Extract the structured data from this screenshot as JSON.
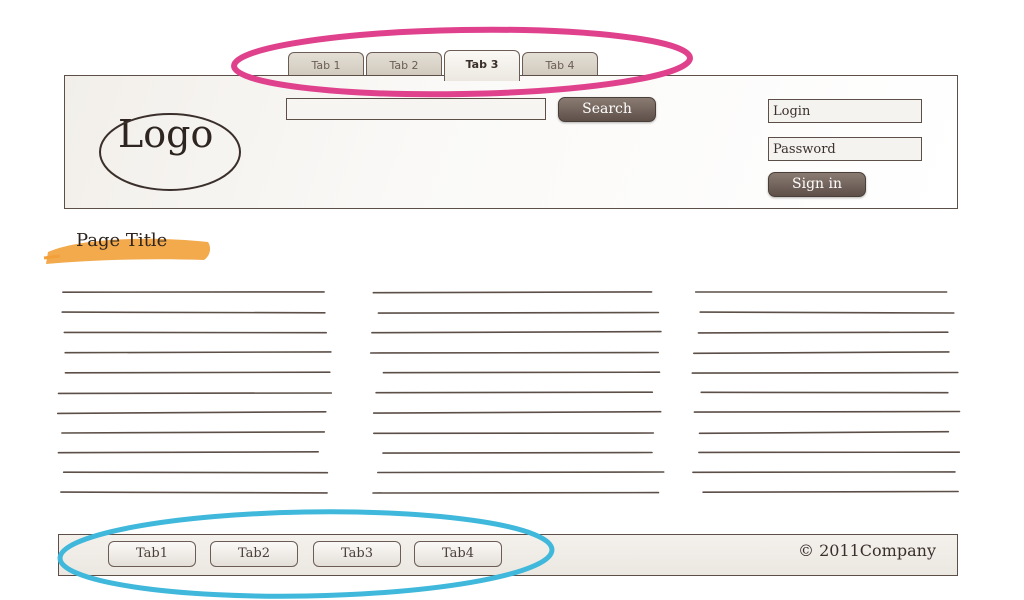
{
  "top_tabs": [
    "Tab 1",
    "Tab 2",
    "Tab 3",
    "Tab 4"
  ],
  "header": {
    "logo": "Logo",
    "search_button": "Search",
    "login_placeholder": "Login",
    "password_placeholder": "Password",
    "signin_button": "Sign in"
  },
  "page_title": "Page Title",
  "footer": {
    "tabs": [
      "Tab1",
      "Tab2",
      "Tab3",
      "Tab4"
    ],
    "copyright": "© 2011Company"
  },
  "colors": {
    "top_highlight": "#e0418c",
    "bottom_highlight": "#3fb8dc",
    "title_brush": "#f2a13a",
    "ink": "#5c4f48"
  }
}
